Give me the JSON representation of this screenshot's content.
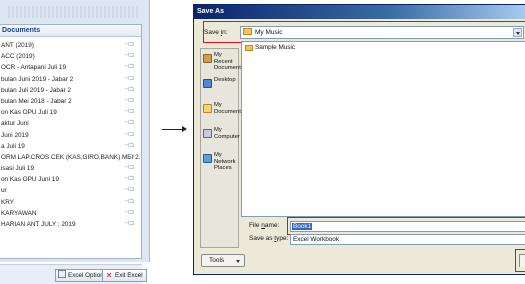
{
  "recent_documents": {
    "title": "Documents",
    "items": [
      "ANT (2019)",
      "ACC (2019)",
      "OCR - Antapani Juli 19",
      "bulan Juni 2019 - Jabar 2",
      "bulan Juli 2019 - Jabar 2",
      "bulan Mei 2018 - Jabar 2",
      "on Kas OPU Juli 19",
      "aktur Juni",
      "Juni 2019",
      "a Juli 19",
      "ORM LAP.CROS CEK (KAS,GIRO,BANK) MEI 2...",
      "isasi Juli 19",
      "on Kas OPU Juni 19",
      "ur",
      "KRY",
      "KARYAWAN",
      "HARIAN ANT JULY ; 2019"
    ],
    "pin_glyph": "⊣⊐",
    "options_button": "Excel Options",
    "exit_button": "Exit Excel"
  },
  "save_as_dialog": {
    "title": "Save As",
    "save_in_label_pre": "Save ",
    "save_in_label_key": "i",
    "save_in_label_post": "n:",
    "save_in_value": "My Music",
    "places": [
      {
        "label": "My Recent Documents",
        "icon": "recent-documents-icon"
      },
      {
        "label": "Desktop",
        "icon": "desktop-icon"
      },
      {
        "label": "My Documents",
        "icon": "my-documents-icon"
      },
      {
        "label": "My Computer",
        "icon": "my-computer-icon"
      },
      {
        "label": "My Network Places",
        "icon": "network-places-icon"
      }
    ],
    "files": [
      "Sample Music"
    ],
    "file_name_label_pre": "File ",
    "file_name_label_key": "n",
    "file_name_label_post": "ame:",
    "file_name_value": "Book1",
    "save_as_type_label_pre": "Save as ",
    "save_as_type_label_key": "t",
    "save_as_type_label_post": "ype:",
    "save_as_type_value": "Excel Workbook",
    "tools_button": "Tools"
  },
  "colors": {
    "highlight_box": "#e0101a",
    "titlebar": "#0a246a",
    "selection": "#316ac5"
  }
}
